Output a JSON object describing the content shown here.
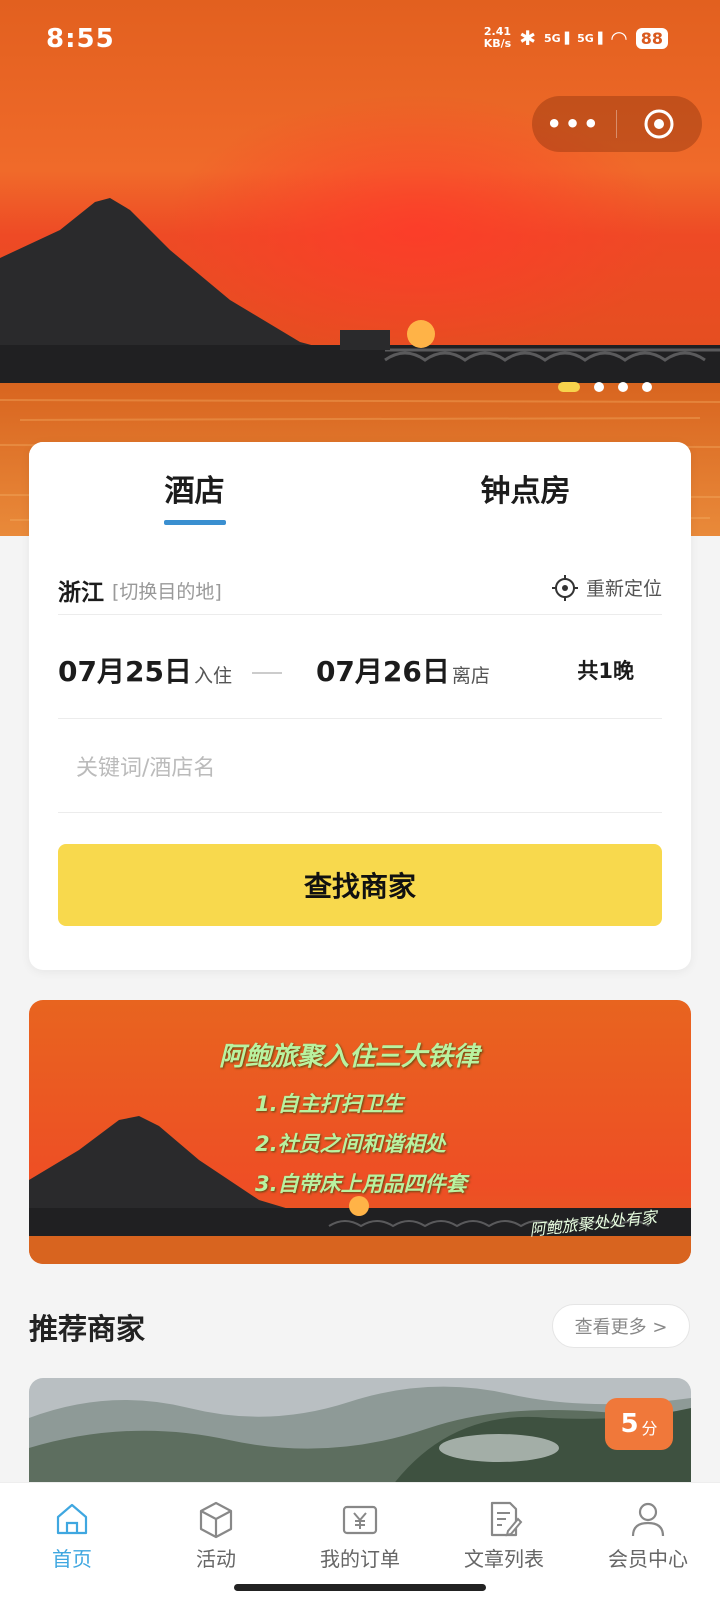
{
  "status_bar": {
    "time": "8:55",
    "net_speed_top": "2.41",
    "net_speed_unit": "KB/s",
    "signal1_label": "5G",
    "signal2_label": "5G",
    "battery": "88"
  },
  "capsule": {
    "menu_icon": "more-dots-icon",
    "close_icon": "target-circle-icon"
  },
  "hero": {
    "slide_count": 4,
    "active_slide": 1
  },
  "booking": {
    "tabs": [
      {
        "label": "酒店",
        "active": true
      },
      {
        "label": "钟点房",
        "active": false
      }
    ],
    "location": {
      "city": "浙江",
      "switch_label": "[切换目的地]",
      "relocate_label": "重新定位"
    },
    "dates": {
      "checkin": "07月25日",
      "checkin_label": "入住",
      "checkout": "07月26日",
      "checkout_label": "离店",
      "nights": "共1晚"
    },
    "search": {
      "placeholder": "关键词/酒店名"
    },
    "find_button": "查找商家"
  },
  "banner": {
    "title": "阿鲍旅聚入住三大铁律",
    "rules": [
      "1.自主打扫卫生",
      "2.社员之间和谐相处",
      "3.自带床上用品四件套"
    ],
    "signature": "阿鲍旅聚处处有家"
  },
  "recommend": {
    "title": "推荐商家",
    "see_more": "查看更多 >",
    "score_value": "5",
    "score_unit": "分"
  },
  "tabbar": [
    {
      "label": "首页",
      "icon": "home-icon",
      "active": true
    },
    {
      "label": "活动",
      "icon": "box-icon",
      "active": false
    },
    {
      "label": "我的订单",
      "icon": "yen-ticket-icon",
      "active": false
    },
    {
      "label": "文章列表",
      "icon": "document-edit-icon",
      "active": false
    },
    {
      "label": "会员中心",
      "icon": "user-icon",
      "active": false
    }
  ],
  "colors": {
    "accent_yellow": "#f8d94d",
    "accent_blue": "#3fa7e0",
    "score_orange": "#f0783a"
  }
}
